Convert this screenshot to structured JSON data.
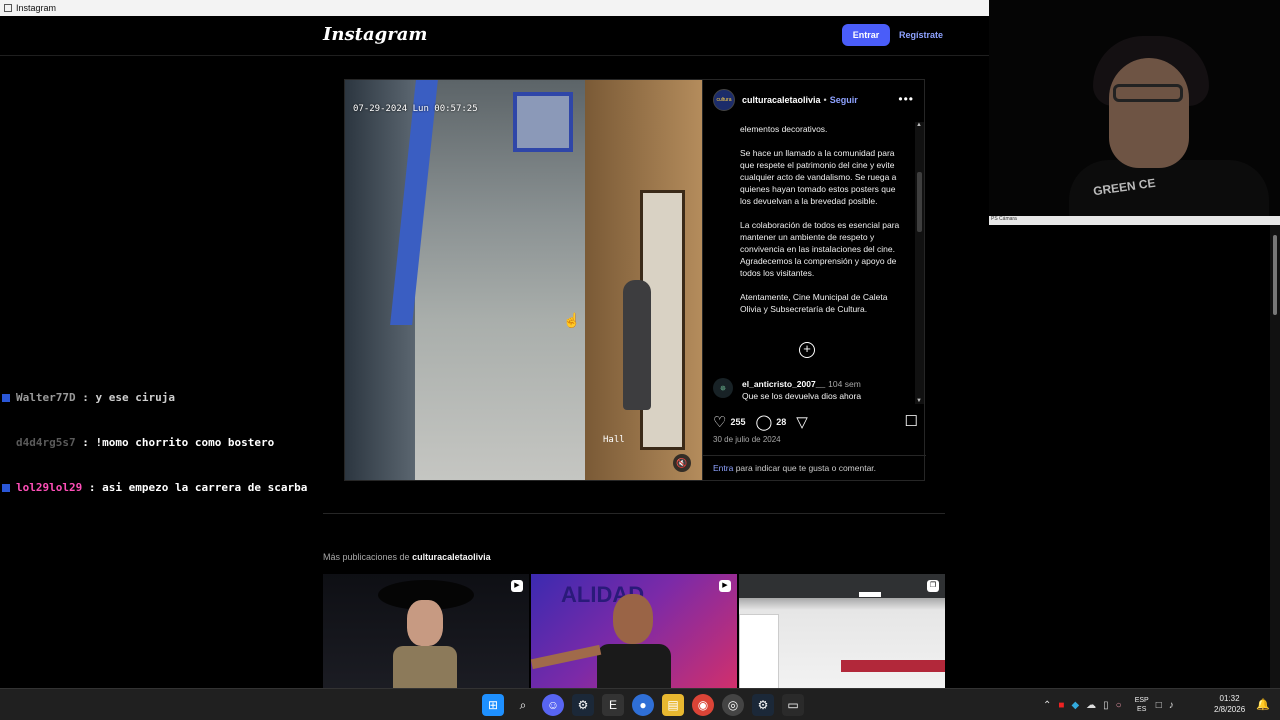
{
  "window": {
    "title": "Instagram"
  },
  "header": {
    "logo": "Instagram",
    "login_label": "Entrar",
    "signup_label": "Regístrate"
  },
  "post": {
    "video": {
      "timestamp": "07-29-2024 Lun 00:57:25",
      "camera_label": "Hall"
    },
    "author": {
      "username": "culturacaletaolivia",
      "follow_label": "Seguir",
      "separator": "•",
      "avatar_text": "cultura"
    },
    "caption_paragraphs": [
      "elementos decorativos.",
      "Se hace un llamado a la comunidad para que respete el patrimonio del cine y evite cualquier acto de vandalismo. Se ruega a quienes hayan tomado estos posters que los devuelvan a la brevedad posible.",
      "La colaboración de todos es esencial para mantener un ambiente de respeto y convivencia en las instalaciones del cine. Agradecemos la comprensión y apoyo de todos los visitantes.",
      "Atentamente, Cine Municipal de Caleta Olivia y Subsecretaría de Cultura."
    ],
    "comment": {
      "username": "el_anticristo_2007__",
      "time": "104 sem",
      "text": "Que se los devuelva dios ahora"
    },
    "likes": "255",
    "comments_count": "28",
    "date": "30 de julio de 2024",
    "login_prompt": {
      "link": "Entra",
      "rest": " para indicar que te gusta o comentar."
    }
  },
  "more_posts": {
    "prefix": "Más publicaciones de ",
    "username": "culturacaletaolivia"
  },
  "chat": [
    {
      "user": "Walter77D",
      "sep": " : ",
      "message": "y ese ciruja"
    },
    {
      "user": "d4d4rg5s7",
      "sep": " : ",
      "message": "!momo chorrito como bostero"
    },
    {
      "user": "lol29lol29",
      "sep": " : ",
      "message": "asi empezo la carrera de scarba"
    }
  ],
  "webcam": {
    "caption": "PS Cámara",
    "shirt_text": "GREEN CE"
  },
  "taskbar": {
    "lang_top": "ESP",
    "lang_bottom": "ES",
    "time": "01:32",
    "date": "2/8/2026"
  },
  "colors": {
    "accent": "#4a5df9",
    "link": "#8ea2ff",
    "chat_pink": "#ff4fb8"
  }
}
